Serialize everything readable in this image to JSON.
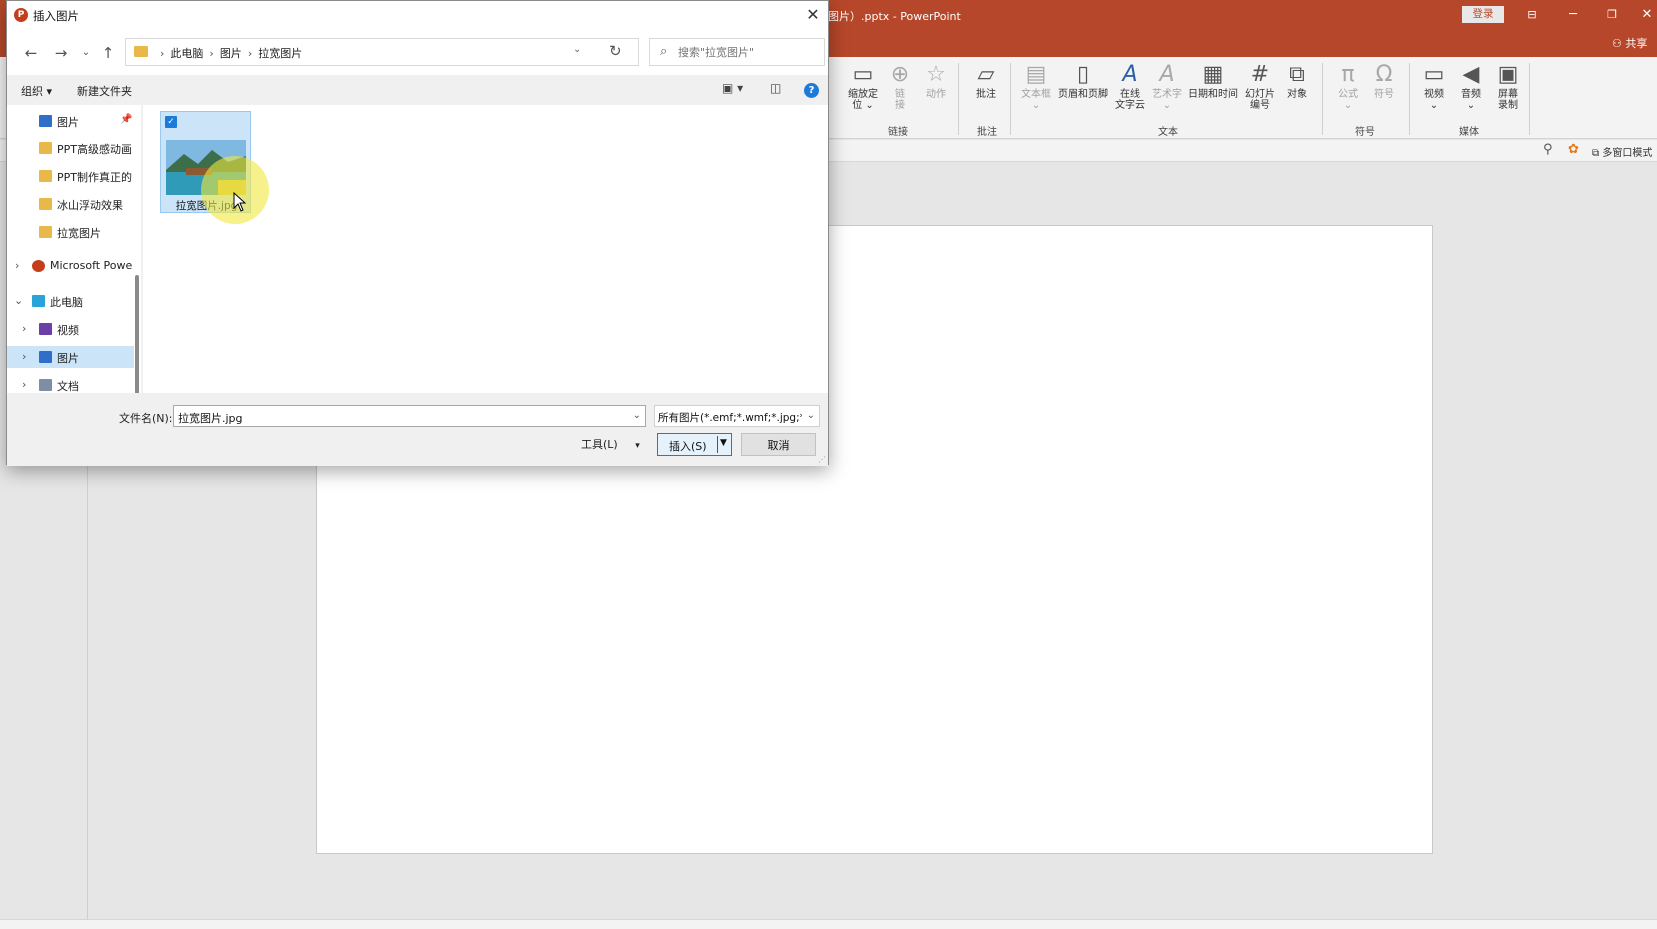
{
  "ppt": {
    "title": "图片）.pptx - PowerPoint",
    "login": "登录",
    "share": "共享",
    "multi_window": "多窗口模式",
    "ribbon": {
      "items": {
        "zoom": "缩放定\n位 ⌄",
        "link": "链\n接",
        "action": "动作",
        "comment": "批注",
        "textbox": "文本框\n⌄",
        "header_footer": "页眉和页脚",
        "online_wordart": "在线\n文字云",
        "wordart": "艺术字\n⌄",
        "datetime": "日期和时间",
        "slide_number": "幻灯片\n编号",
        "object": "对象",
        "equation": "公式\n⌄",
        "symbol": "符号",
        "video": "视频\n⌄",
        "audio": "音频\n⌄",
        "screen_record": "屏幕\n录制"
      },
      "groups": {
        "links": "链接",
        "comments": "批注",
        "text": "文本",
        "symbols": "符号",
        "media": "媒体"
      }
    }
  },
  "dialog": {
    "title": "插入图片",
    "breadcrumb": [
      "此电脑",
      "图片",
      "拉宽图片"
    ],
    "search_placeholder": "搜索\"拉宽图片\"",
    "organize": "组织 ▾",
    "new_folder": "新建文件夹",
    "tree": [
      {
        "label": "图片",
        "icon": "pictures-icon",
        "pinned": true
      },
      {
        "label": "PPT高级感动画",
        "icon": "folder-icon"
      },
      {
        "label": "PPT制作真正的",
        "icon": "folder-icon"
      },
      {
        "label": "冰山浮动效果",
        "icon": "folder-icon"
      },
      {
        "label": "拉宽图片",
        "icon": "folder-icon"
      },
      {
        "label": "Microsoft Powe",
        "icon": "powerpoint-icon"
      },
      {
        "label": "此电脑",
        "icon": "computer-icon"
      },
      {
        "label": "视频",
        "icon": "videos-icon"
      },
      {
        "label": "图片",
        "icon": "pictures-icon"
      },
      {
        "label": "文档",
        "icon": "documents-icon"
      }
    ],
    "files": [
      {
        "name": "拉宽图片.jpg",
        "selected": true
      }
    ],
    "filename_label": "文件名(N):",
    "filename_value": "拉宽图片.jpg",
    "filter_value": "所有图片(*.emf;*.wmf;*.jpg;*.j",
    "tools": "工具(L)",
    "insert": "插入(S)",
    "cancel": "取消"
  },
  "colors": {
    "accent": "#b7472a",
    "selection": "#cce4f7",
    "primary_button_border": "#1c7bd9"
  }
}
